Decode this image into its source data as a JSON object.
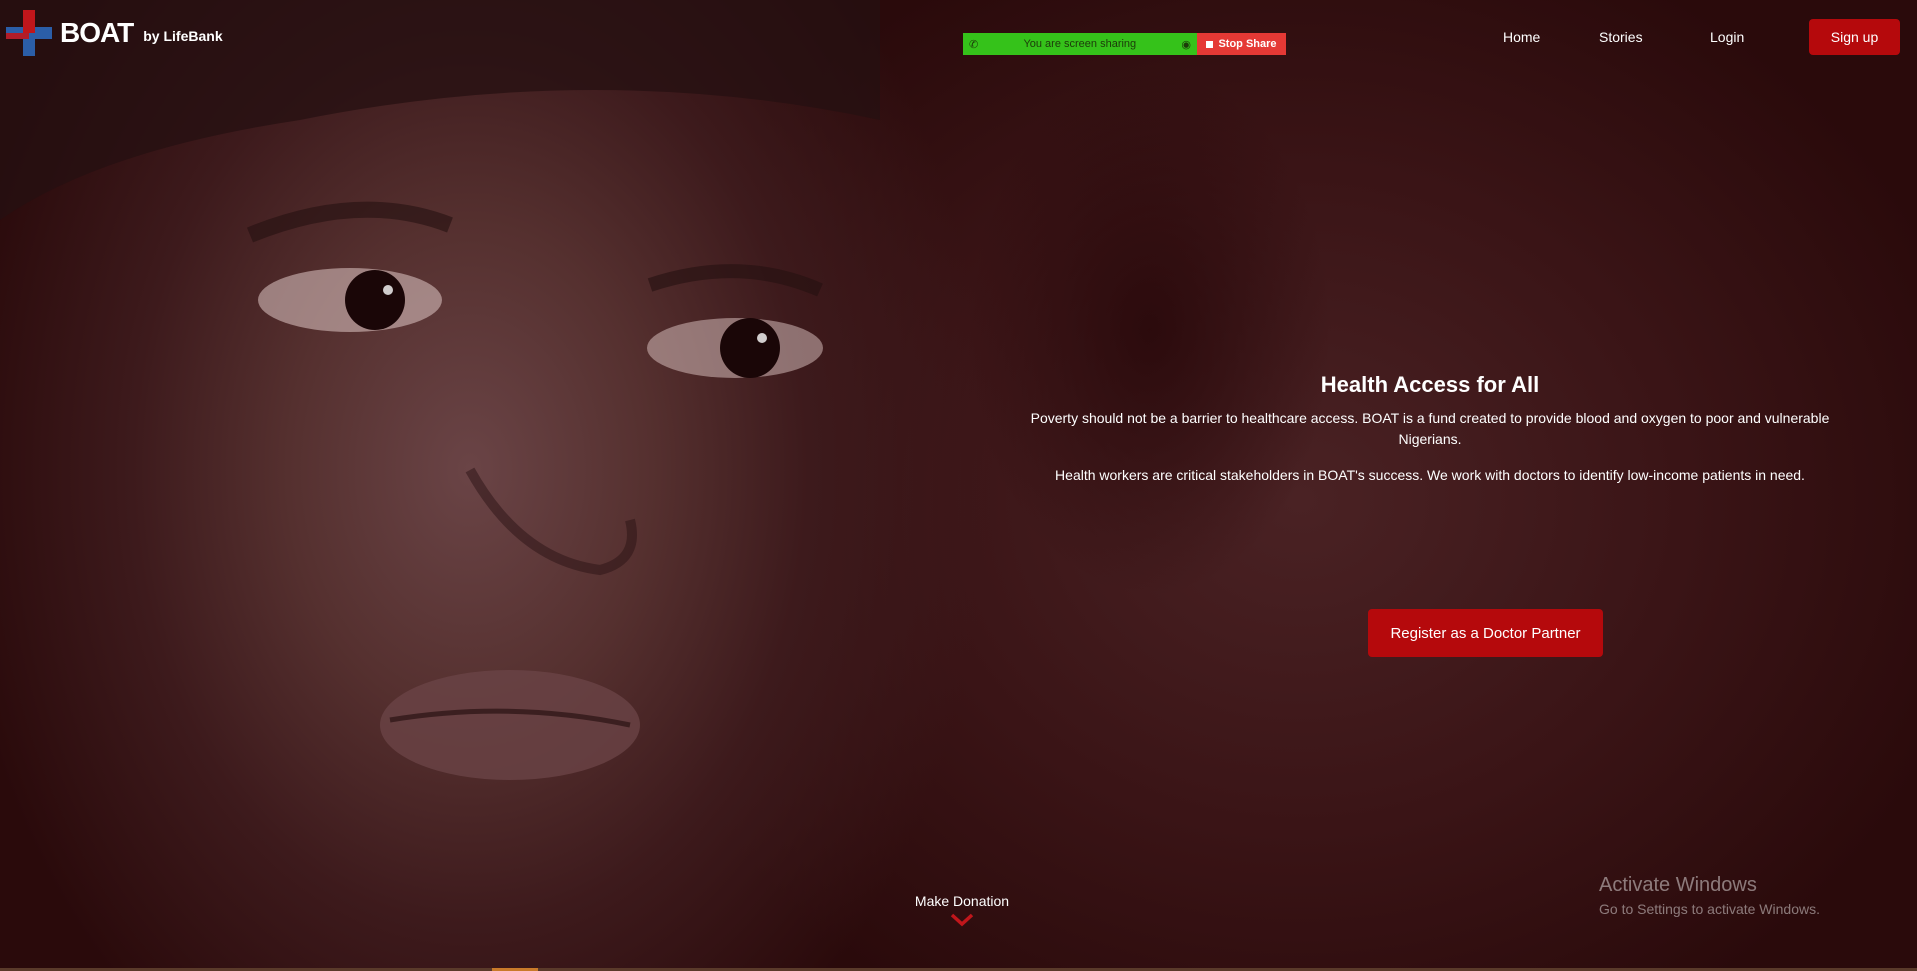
{
  "brand": {
    "name": "BOAT",
    "by": "by LifeBank",
    "logo_colors": [
      "#2b5ea8",
      "#c0161b"
    ]
  },
  "screen_share": {
    "status_text": "You are screen sharing",
    "stop_label": "Stop Share"
  },
  "nav": {
    "home": "Home",
    "stories": "Stories",
    "login": "Login",
    "signup": "Sign up"
  },
  "hero": {
    "title": "Health Access for All",
    "paragraph_1": "Poverty should not be a barrier to healthcare access. BOAT is a fund created to provide blood and oxygen to poor and vulnerable Nigerians.",
    "paragraph_2": "Health workers are critical stakeholders in BOAT's success. We work with doctors to identify low-income patients in need.",
    "cta_label": "Register as a Doctor Partner"
  },
  "donation": {
    "label": "Make Donation"
  },
  "windows_watermark": {
    "title": "Activate Windows",
    "subtitle": "Go to Settings to activate Windows."
  },
  "colors": {
    "accent_red": "#b5090c",
    "share_green": "#35c21a",
    "share_red": "#e53935",
    "background": "#2a0a0b"
  }
}
